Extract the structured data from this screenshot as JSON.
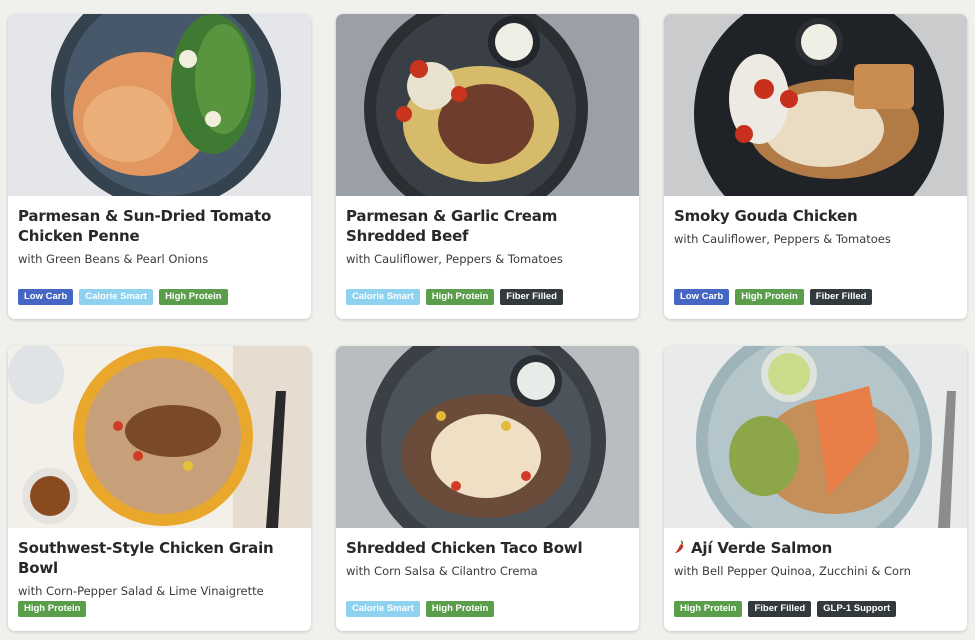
{
  "cards": [
    {
      "title": "Parmesan & Sun-Dried Tomato Chicken Penne",
      "subtitle": "with Green Beans & Pearl Onions",
      "badges": [
        "Low Carb",
        "Calorie Smart",
        "High Protein"
      ]
    },
    {
      "title": "Parmesan & Garlic Cream Shredded Beef",
      "subtitle": "with Cauliflower, Peppers & Tomatoes",
      "badges": [
        "Calorie Smart",
        "High Protein",
        "Fiber Filled"
      ]
    },
    {
      "title": "Smoky Gouda Chicken",
      "subtitle": "with Cauliflower, Peppers & Tomatoes",
      "badges": [
        "Low Carb",
        "High Protein",
        "Fiber Filled"
      ]
    },
    {
      "title": "Southwest-Style Chicken Grain Bowl",
      "subtitle": "with Corn-Pepper Salad & Lime Vinaigrette",
      "badges": [
        "High Protein"
      ]
    },
    {
      "title": "Shredded Chicken Taco Bowl",
      "subtitle": "with Corn Salsa & Cilantro Crema",
      "badges": [
        "Calorie Smart",
        "High Protein"
      ]
    },
    {
      "title": "Ají Verde Salmon",
      "subtitle": "with Bell Pepper Quinoa, Zucchini & Corn",
      "badges": [
        "High Protein",
        "Fiber Filled",
        "GLP-1 Support"
      ],
      "icon": "chili-pepper-icon"
    }
  ],
  "colors": {
    "low_carb": "#4666c4",
    "calorie_smart": "#8fd2f0",
    "high_protein": "#5a9e4b",
    "fiber_filled": "#333a3d",
    "glp1_support": "#333a3d",
    "spicy": "#c0392b"
  }
}
